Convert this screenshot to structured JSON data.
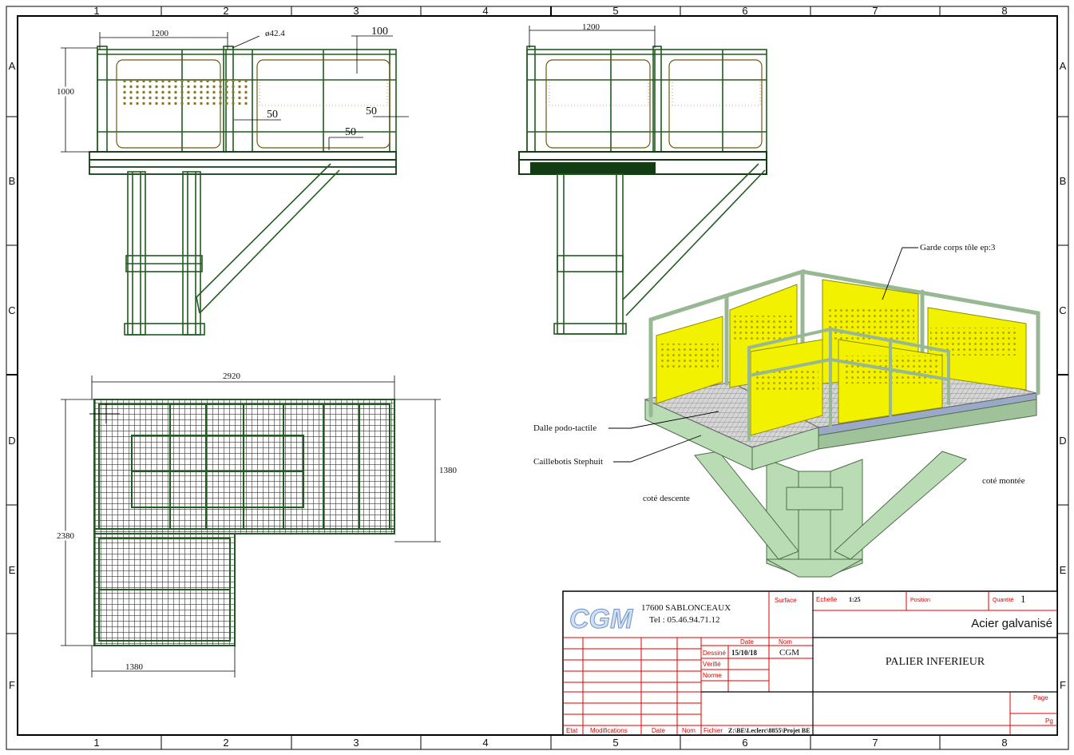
{
  "border": {
    "columns": [
      "1",
      "2",
      "3",
      "4",
      "5",
      "6",
      "7",
      "8"
    ],
    "rows": [
      "A",
      "B",
      "C",
      "D",
      "E",
      "F"
    ]
  },
  "front_view": {
    "dim_width": "1200",
    "dim_height": "1000",
    "dim_tube": "ø42.4",
    "dim_top": "100",
    "dim_gap1": "50",
    "dim_gap2": "50",
    "dim_gap3": "50"
  },
  "side_view": {
    "dim_width": "1200"
  },
  "plan_view": {
    "dim_total_width": "2920",
    "dim_depth": "1380",
    "dim_total_height": "2380",
    "dim_bottom_width": "1380"
  },
  "iso_view": {
    "label_guardrail": "Garde corps tôle ep:3",
    "label_tactile": "Dalle podo-tactile",
    "label_grating": "Caillebotis Stephuit",
    "label_descent": "coté descente",
    "label_ascent": "coté montée",
    "colors": {
      "frame": "#b9dcb4",
      "panel": "#f2f200",
      "grating": "#cfcfcf"
    }
  },
  "title_block": {
    "logo": "CGM",
    "address": "17600 SABLONCEAUX",
    "phone": "Tel : 05.46.94.71.12",
    "surface_label": "Surface",
    "scale_label": "Echelle",
    "scale_value": "1:25",
    "position_label": "Position",
    "quantity_label": "Quantité",
    "quantity_value": "1",
    "material": "Acier galvanisé",
    "date_header": "Date",
    "name_header": "Nom",
    "drawn_label": "Dessiné",
    "drawn_date": "15/10/18",
    "drawn_name": "CGM",
    "checked_label": "Vérifié",
    "norm_label": "Norme",
    "title": "PALIER INFERIEUR",
    "page_label": "Page",
    "pg_label": "Pg",
    "col_etat": "Etat",
    "col_modifications": "Modifications",
    "col_date": "Date",
    "col_nom": "Nom",
    "file_label": "Fichier",
    "file_path": "Z:\\BE\\Leclerc\\8855\\Projet BE"
  }
}
